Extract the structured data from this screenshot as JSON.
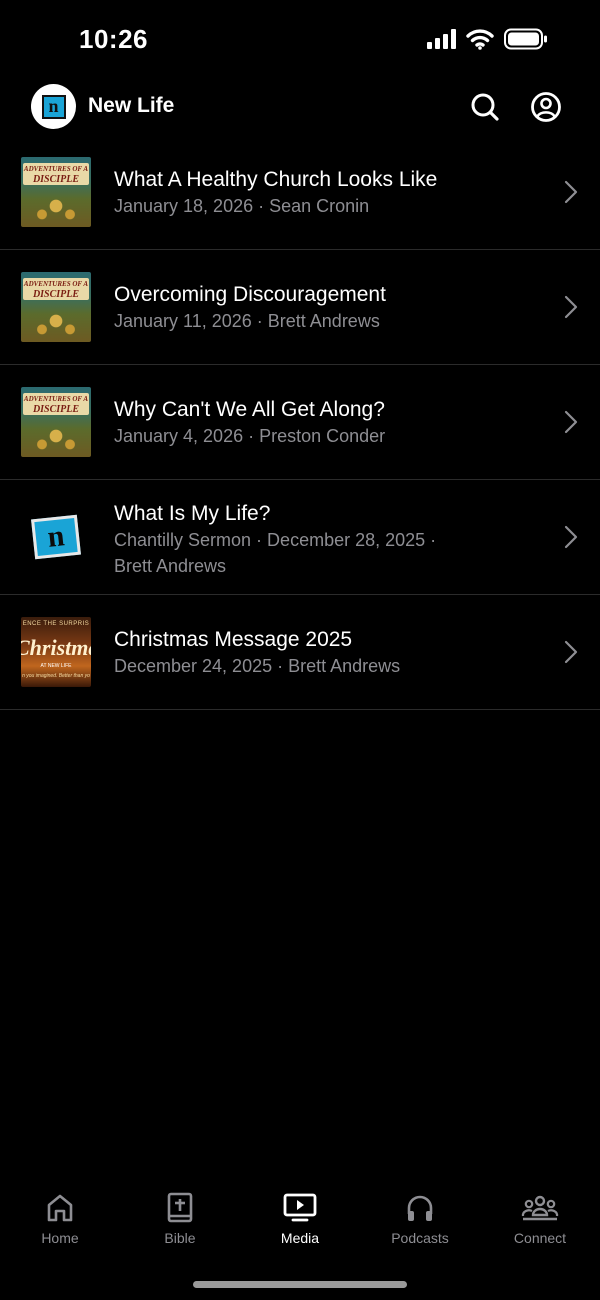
{
  "status": {
    "time": "10:26"
  },
  "header": {
    "app_name": "New Life",
    "logo_letter": "n"
  },
  "items": [
    {
      "title": "What A Healthy Church Looks Like",
      "meta": "January 18, 2026 · Sean Cronin",
      "thumb_line1": "ADVENTURES OF A",
      "thumb_line2": "DISCIPLE"
    },
    {
      "title": "Overcoming Discouragement",
      "meta": "January 11, 2026 · Brett Andrews",
      "thumb_line1": "ADVENTURES OF A",
      "thumb_line2": "DISCIPLE"
    },
    {
      "title": "Why Can't We All Get Along?",
      "meta": "January 4, 2026 · Preston Conder",
      "thumb_line1": "ADVENTURES OF A",
      "thumb_line2": "DISCIPLE"
    },
    {
      "title": "What Is My Life?",
      "meta_line1": "Chantilly Sermon · December 28, 2025 ·",
      "meta_line2": "Brett Andrews",
      "thumb_letter": "n"
    },
    {
      "title": "Christmas Message 2025",
      "meta": "December 24, 2025 · Brett Andrews",
      "thumb_line1": "ENCE THE SURPRIS",
      "thumb_line2": "Christmas",
      "thumb_line3": "AT NEW LIFE",
      "thumb_line4": "n you imagined. Better than yo"
    }
  ],
  "tabs": [
    {
      "label": "Home",
      "icon": "home-icon",
      "active": false
    },
    {
      "label": "Bible",
      "icon": "bible-icon",
      "active": false
    },
    {
      "label": "Media",
      "icon": "media-icon",
      "active": true
    },
    {
      "label": "Podcasts",
      "icon": "headphones-icon",
      "active": false
    },
    {
      "label": "Connect",
      "icon": "people-icon",
      "active": false
    }
  ],
  "colors": {
    "background": "#000000",
    "secondary_text": "#8e8e93",
    "divider": "#2b2b2b",
    "brand_blue": "#1aa4d6"
  }
}
